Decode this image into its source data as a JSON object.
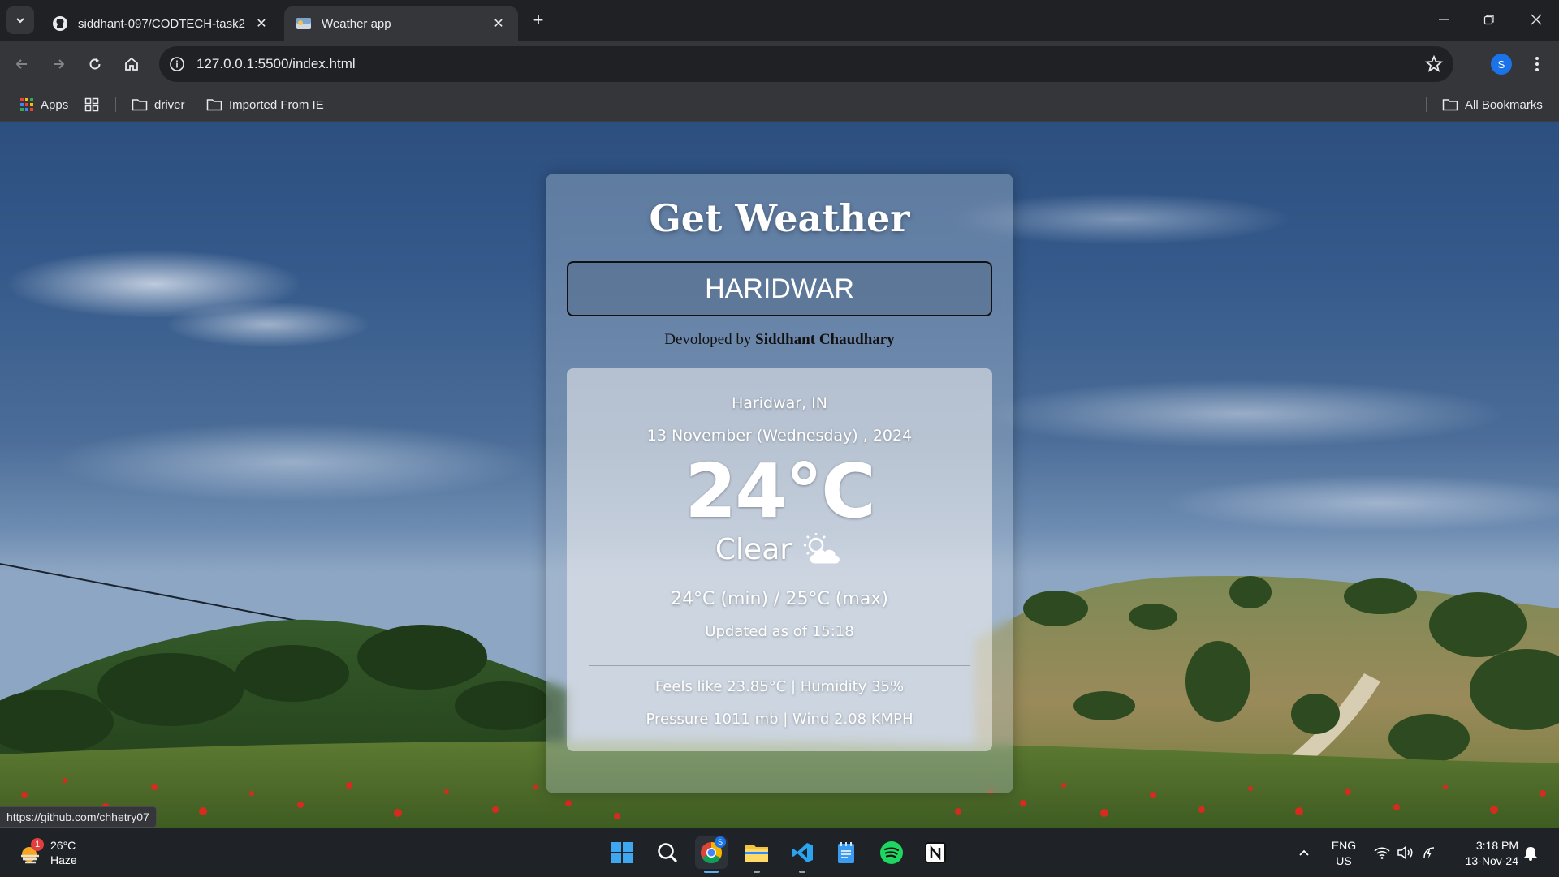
{
  "browser": {
    "tabs": [
      {
        "title": "siddhant-097/CODTECH-task2",
        "icon": "github-icon",
        "active": false
      },
      {
        "title": "Weather app",
        "icon": "weather-favicon",
        "active": true
      }
    ],
    "url": "127.0.0.1:5500/index.html",
    "profile_initial": "S",
    "bookmarks": {
      "apps": "Apps",
      "driver": "driver",
      "imported": "Imported From IE",
      "all": "All Bookmarks"
    },
    "status_url": "https://github.com/chhetry07"
  },
  "app": {
    "title": "Get Weather",
    "search_value": "HARIDWAR",
    "credit_prefix": "Devoloped by",
    "credit_name": "Siddhant Chaudhary",
    "weather": {
      "location": "Haridwar, IN",
      "date": "13 November (Wednesday) , 2024",
      "temperature": "24°C",
      "condition": "Clear",
      "condition_icon": "partly-cloudy-icon",
      "minmax": "24°C (min) / 25°C (max)",
      "updated": "Updated as of 15:18",
      "feels_humidity": "Feels like 23.85°C | Humidity 35%",
      "pressure_wind": "Pressure 1011 mb | Wind 2.08 KMPH"
    }
  },
  "taskbar": {
    "weather_temp": "26°C",
    "weather_desc": "Haze",
    "notification_count": "1",
    "lang_top": "ENG",
    "lang_bottom": "US",
    "time": "3:18 PM",
    "date": "13-Nov-24",
    "chrome_badge": "S"
  }
}
